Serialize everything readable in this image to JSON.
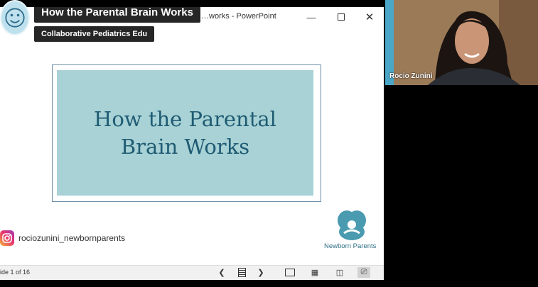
{
  "window": {
    "title": "…works - PowerPoint",
    "minimize_icon": "minimize-icon",
    "maximize_icon": "maximize-icon",
    "close_icon": "close-icon"
  },
  "overlay": {
    "video_title": "How the Parental Brain Works",
    "channel_name": "Collaborative Pediatrics Edu"
  },
  "slide": {
    "title_line1": "How the Parental",
    "title_line2": "Brain Works",
    "instagram_handle": "rociozunini_newbornparents",
    "logo_text": "Newborn Parents"
  },
  "statusbar": {
    "slide_counter": "ide 1 of 16"
  },
  "participant": {
    "name": "Rocio Zunini"
  },
  "colors": {
    "title_panel": "#a8d2d5",
    "title_text": "#1f5b73",
    "logo": "#4a9bb0"
  }
}
